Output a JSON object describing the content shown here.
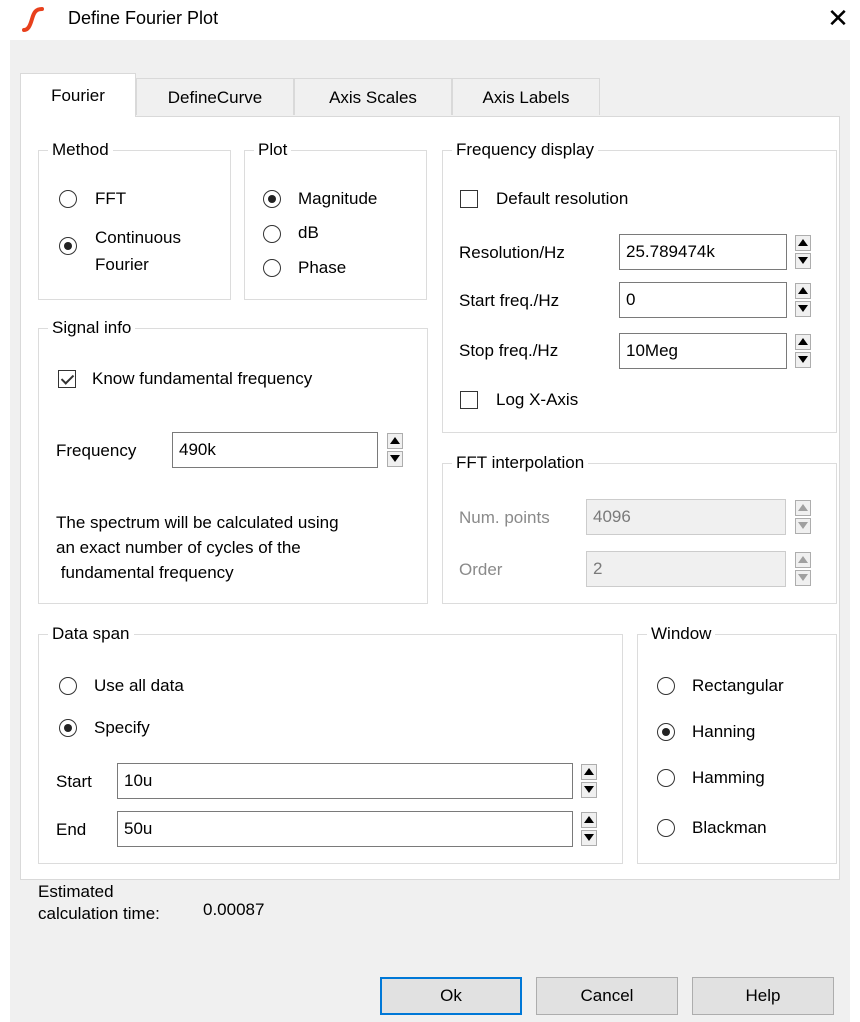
{
  "window": {
    "title": "Define Fourier Plot",
    "close_symbol": "✕"
  },
  "tabs": [
    "Fourier",
    "DefineCurve",
    "Axis Scales",
    "Axis Labels"
  ],
  "method": {
    "legend": "Method",
    "fft_label": "FFT",
    "continuous_line1": "Continuous",
    "continuous_line2": "Fourier",
    "selected": "Continuous Fourier"
  },
  "plot": {
    "legend": "Plot",
    "magnitude_label": "Magnitude",
    "db_label": "dB",
    "phase_label": "Phase",
    "selected": "Magnitude"
  },
  "frequency_display": {
    "legend": "Frequency display",
    "default_resolution_label": "Default resolution",
    "default_resolution_checked": false,
    "resolution_label": "Resolution/Hz",
    "resolution_value": "25.789474k",
    "start_label": "Start freq./Hz",
    "start_value": "0",
    "stop_label": "Stop freq./Hz",
    "stop_value": "10Meg",
    "logx_label": "Log X-Axis",
    "logx_checked": false
  },
  "signal_info": {
    "legend": "Signal info",
    "know_label": "Know fundamental frequency",
    "know_checked": true,
    "frequency_label": "Frequency",
    "frequency_value": "490k",
    "note_line1": "The spectrum will be calculated using",
    "note_line2": "an exact number of cycles of the",
    "note_line3": " fundamental frequency"
  },
  "fft_interpolation": {
    "legend": "FFT interpolation",
    "num_points_label": "Num. points",
    "num_points_value": "4096",
    "order_label": "Order",
    "order_value": "2"
  },
  "data_span": {
    "legend": "Data span",
    "use_all_label": "Use all data",
    "specify_label": "Specify",
    "selected": "Specify",
    "start_label": "Start",
    "start_value": "10u",
    "end_label": "End",
    "end_value": "50u"
  },
  "window_fn": {
    "legend": "Window",
    "options": [
      "Rectangular",
      "Hanning",
      "Hamming",
      "Blackman"
    ],
    "selected": "Hanning"
  },
  "estimate": {
    "label_line1": "Estimated",
    "label_line2": "calculation time:",
    "value": "0.00087"
  },
  "buttons": {
    "ok": "Ok",
    "cancel": "Cancel",
    "help": "Help"
  },
  "colors": {
    "accent": "#0078d7",
    "logo": "#e8401c"
  }
}
